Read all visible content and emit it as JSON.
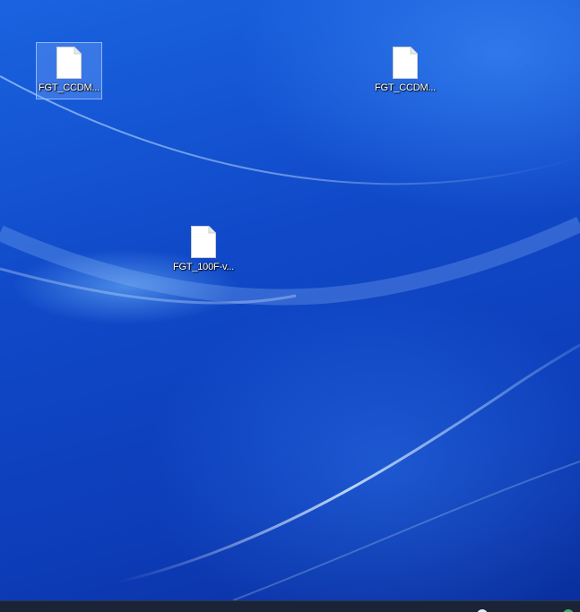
{
  "desktop": {
    "icons": [
      {
        "label": "FGT_CCDM...",
        "icon": "file-icon",
        "selected": true
      },
      {
        "label": "FGT_CCDM...",
        "icon": "file-icon",
        "selected": false
      },
      {
        "label": "FGT_100F-v...",
        "icon": "file-icon",
        "selected": false
      }
    ]
  },
  "taskbar": {
    "tray_icons": [
      "tray-app-icon-white",
      "tray-app-icon-green"
    ]
  },
  "colors": {
    "wallpaper": "#1049c8",
    "taskbar": "#1b2436",
    "selection": "#78aaff"
  }
}
